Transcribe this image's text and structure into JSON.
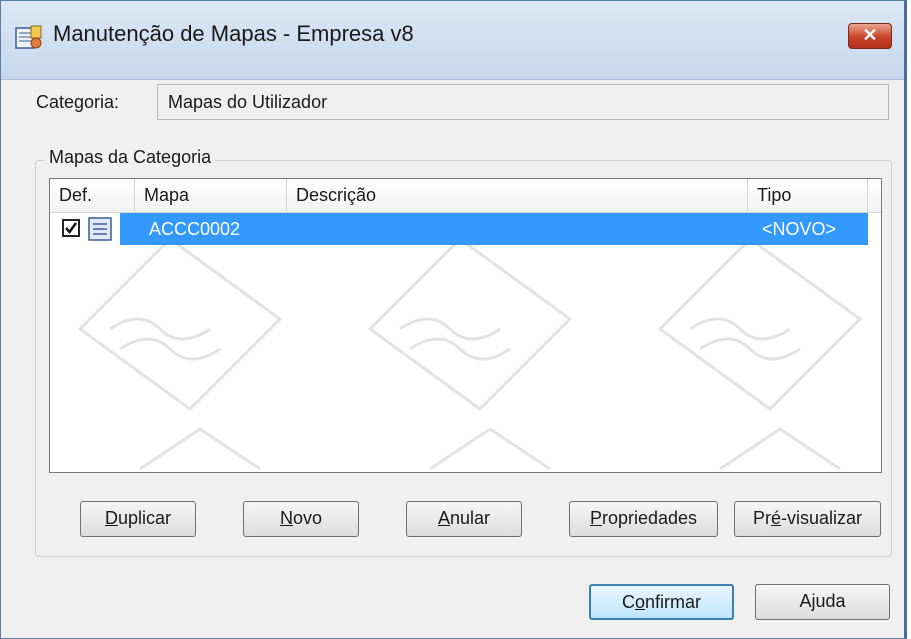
{
  "window": {
    "title": "Manutenção de Mapas - Empresa v8",
    "close_label": "✕"
  },
  "category": {
    "label": "Categoria:",
    "value": "Mapas do Utilizador"
  },
  "group": {
    "label": "Mapas da Categoria"
  },
  "table": {
    "columns": [
      "Def.",
      "Mapa",
      "Descrição",
      "Tipo"
    ],
    "rows": [
      {
        "def_checked": true,
        "mapa": "ACCC0002",
        "descricao": "",
        "tipo": "<NOVO>"
      }
    ]
  },
  "buttons": {
    "duplicar": {
      "mnemonic": "D",
      "rest": "uplicar"
    },
    "novo": {
      "mnemonic": "N",
      "rest": "ovo"
    },
    "anular": {
      "mnemonic": "A",
      "rest": "nular"
    },
    "propriedades": {
      "mnemonic": "P",
      "rest": "ropriedades"
    },
    "pre_visualizar": {
      "pre": "Pr",
      "mnemonic": "é",
      "rest": "-visualizar"
    },
    "confirmar": {
      "pre": "C",
      "mnemonic": "o",
      "rest": "nfirmar"
    },
    "ajuda": {
      "pre": "A",
      "mnemonic": "j",
      "rest": "uda"
    }
  },
  "colors": {
    "selection": "#3399ff",
    "close_button": "#c9442a",
    "titlebar": "#c6d7ec"
  }
}
